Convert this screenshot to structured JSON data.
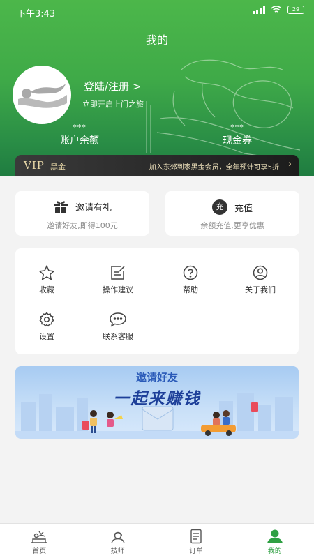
{
  "status": {
    "time": "下午3:43",
    "battery": "29"
  },
  "header": {
    "title": "我的"
  },
  "profile": {
    "login": "登陆/注册 >",
    "subtitle": "立即开启上门之旅"
  },
  "stats": {
    "balance": {
      "value": "***",
      "label": "账户余额"
    },
    "coupon": {
      "value": "***",
      "label": "现金券"
    }
  },
  "vip": {
    "logo": "VIP",
    "tier": "黑金",
    "promo": "加入东郊到家黑金会员，全年预计可享5折",
    "arrow": "›"
  },
  "invite": {
    "title": "邀请有礼",
    "subtitle": "邀请好友,即得100元"
  },
  "recharge": {
    "icon_text": "充",
    "title": "充值",
    "subtitle": "余额充值,更享优惠"
  },
  "menu": {
    "favorites": "收藏",
    "feedback": "操作建议",
    "help": "帮助",
    "about": "关于我们",
    "settings": "设置",
    "support": "联系客服"
  },
  "banner": {
    "line1": "邀请好友",
    "line2": "一起来赚钱"
  },
  "tabs": {
    "home": "首页",
    "technician": "技师",
    "orders": "订单",
    "mine": "我的"
  },
  "colors": {
    "primary": "#3faa48",
    "active_tab": "#2fa043",
    "vip_gold": "#e7d7a8"
  }
}
